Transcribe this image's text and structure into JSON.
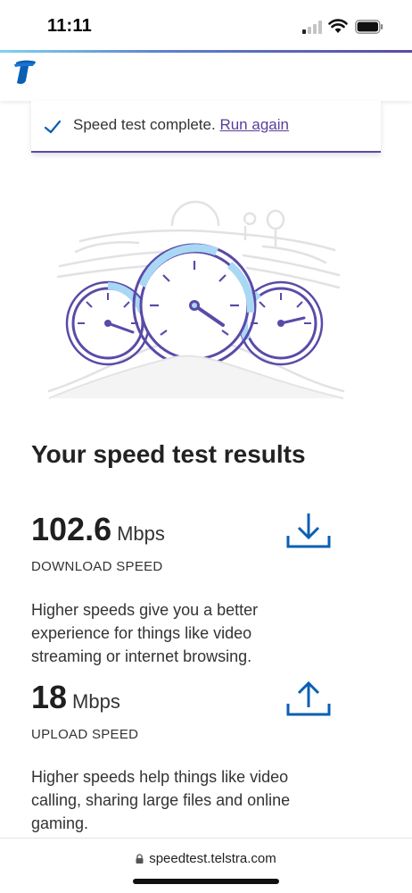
{
  "status_bar": {
    "time": "11:11",
    "signal_bars_on": 1,
    "icons": [
      "cellular-signal-icon",
      "wifi-icon",
      "battery-icon"
    ]
  },
  "header": {
    "logo_icon": "telstra-logo-icon",
    "accent_color": "#5a4aa8"
  },
  "notice": {
    "message": "Speed test complete.",
    "link": "Run again",
    "icon": "checkmark-icon"
  },
  "results": {
    "title": "Your speed test results",
    "download": {
      "value": "102.6",
      "unit": "Mbps",
      "label": "DOWNLOAD SPEED",
      "description": "Higher speeds give you a better experience for things like video streaming or internet browsing.",
      "icon": "download-icon"
    },
    "upload": {
      "value": "18",
      "unit": "Mbps",
      "label": "UPLOAD SPEED",
      "description": "Higher speeds help things like video calling, sharing large files and online gaming.",
      "icon": "upload-icon"
    }
  },
  "browser": {
    "url": "speedtest.telstra.com"
  },
  "colors": {
    "brand_purple": "#5a4aa8",
    "brand_blue": "#0a5fb4",
    "gauge_fill": "#a9d8f5",
    "link": "#5a3f99"
  }
}
